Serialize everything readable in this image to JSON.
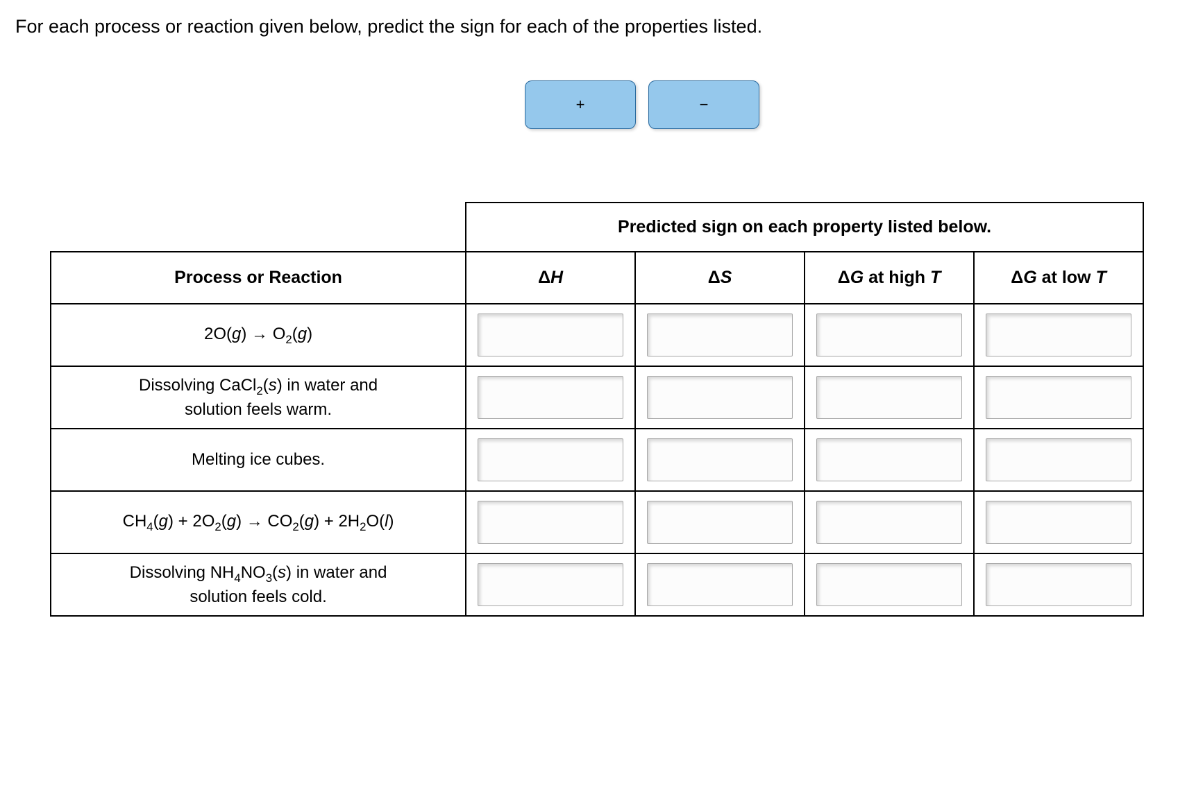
{
  "prompt": "For each process or reaction given below, predict the sign for each of the properties listed.",
  "chips": {
    "plus": "+",
    "minus": "−"
  },
  "banner": "Predicted sign on each property listed below.",
  "headers": {
    "process": "Process or Reaction",
    "dH_delta": "Δ",
    "dH_var": "H",
    "dS_delta": "Δ",
    "dS_var": "S",
    "dG_high_delta": "Δ",
    "dG_high_var": "G",
    "dG_high_suffix": " at high ",
    "dG_high_T": "T",
    "dG_low_delta": "Δ",
    "dG_low_var": "G",
    "dG_low_suffix": " at low ",
    "dG_low_T": "T"
  },
  "rows": {
    "r1": {
      "pre": "2O(",
      "g1": "g",
      "mid1": ") → O",
      "sub1": "2",
      "paren2": "(",
      "g2": "g",
      "end": ")"
    },
    "r2": {
      "line1_pre": "Dissolving CaCl",
      "line1_sub": "2",
      "line1_paren": "(",
      "line1_s": "s",
      "line1_end": ") in water and",
      "line2": "solution feels warm."
    },
    "r3": {
      "text": "Melting ice cubes."
    },
    "r4": {
      "p1": "CH",
      "s1": "4",
      "p2": "(",
      "g1": "g",
      "p3": ") + 2O",
      "s2": "2",
      "p4": "(",
      "g2": "g",
      "p5": ") → CO",
      "s3": "2",
      "p6": "(",
      "g3": "g",
      "p7": ") + 2H",
      "s4": "2",
      "p8": "O(",
      "l1": "l",
      "p9": ")"
    },
    "r5": {
      "line1_pre": "Dissolving NH",
      "line1_sub1": "4",
      "line1_mid": "NO",
      "line1_sub2": "3",
      "line1_paren": "(",
      "line1_s": "s",
      "line1_end": ") in water and",
      "line2": "solution feels cold."
    }
  }
}
